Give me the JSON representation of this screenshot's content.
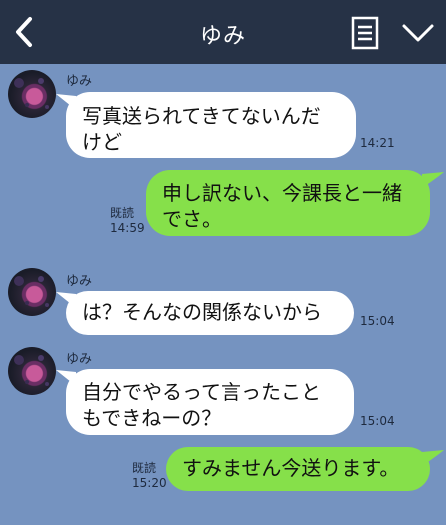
{
  "header": {
    "title": "ゆみ",
    "back_icon": "chevron-left-icon",
    "menu_icon": "notes-icon",
    "collapse_icon": "chevron-down-icon",
    "background": "#263246"
  },
  "colors": {
    "chat_background": "#7593c0",
    "incoming_bubble": "#ffffff",
    "outgoing_bubble": "#86e04a"
  },
  "messages": [
    {
      "direction": "in",
      "sender": "ゆみ",
      "text_line1": "写真送られてきてないんだ",
      "text_line2": "けど",
      "time": "14:21"
    },
    {
      "direction": "out",
      "text_line1": "申し訳ない、今課長と一緒",
      "text_line2": "でさ。",
      "read": "既読",
      "time": "14:59"
    },
    {
      "direction": "in",
      "sender": "ゆみ",
      "text_line1": "は？そんなの関係ないから",
      "time": "15:04"
    },
    {
      "direction": "in",
      "sender": "ゆみ",
      "text_line1": "自分でやるって言ったこと",
      "text_line2": "もできねーの？",
      "time": "15:04"
    },
    {
      "direction": "out",
      "text_line1": "すみません今送ります。",
      "read": "既読",
      "time": "15:20"
    }
  ]
}
